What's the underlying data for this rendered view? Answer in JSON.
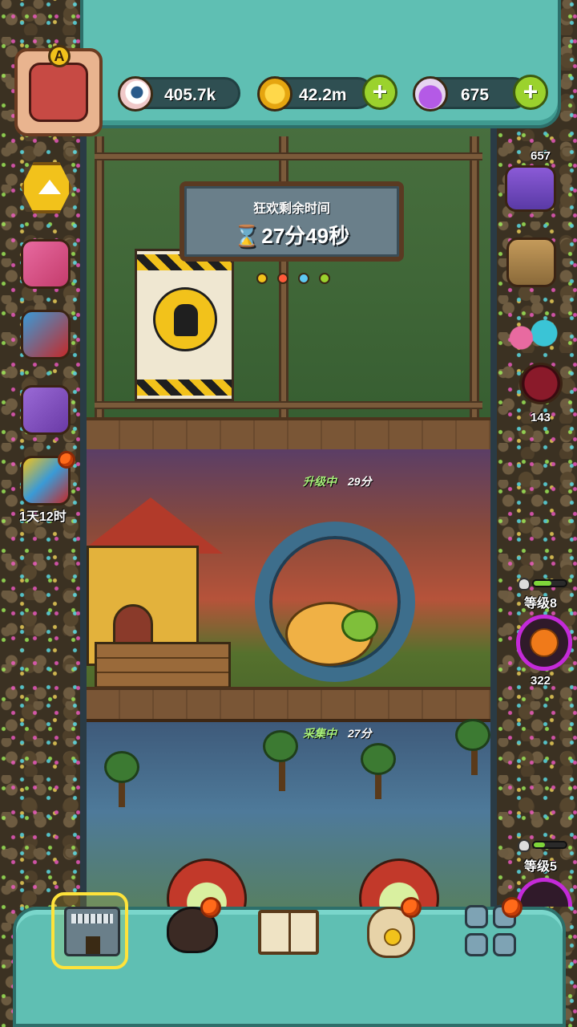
{
  "resources": {
    "eyes": {
      "icon": "eyeball-icon",
      "value": "405.7k"
    },
    "coins": {
      "icon": "gold-coin-icon",
      "value": "42.2m"
    },
    "potion": {
      "icon": "purple-potion-icon",
      "value": "675"
    }
  },
  "player": {
    "grade": "A"
  },
  "event": {
    "title": "狂欢剩余时间",
    "timer": "27分49秒"
  },
  "floors": [
    {
      "state": "升级中",
      "time": "29分"
    },
    {
      "state": "采集中",
      "time": "27分"
    }
  ],
  "left_sidebar": {
    "timed_gift_countdown": "1天12时"
  },
  "right_sidebar": {
    "video_count": "657",
    "item_count": "143",
    "producer_1": {
      "level": "等级8",
      "count": "322",
      "progress": 0.55
    },
    "producer_2": {
      "level": "等级5",
      "progress": 0.35
    }
  },
  "bottom_nav": {
    "selected": "shop"
  },
  "colors": {
    "panel_teal": "#5fbfb3",
    "plus_green": "#9bd22d",
    "notification_orange": "#ff6a1a",
    "status_green": "#a8f07a",
    "level_green": "#7fd63a",
    "ring_purple": "#c42ad9"
  }
}
